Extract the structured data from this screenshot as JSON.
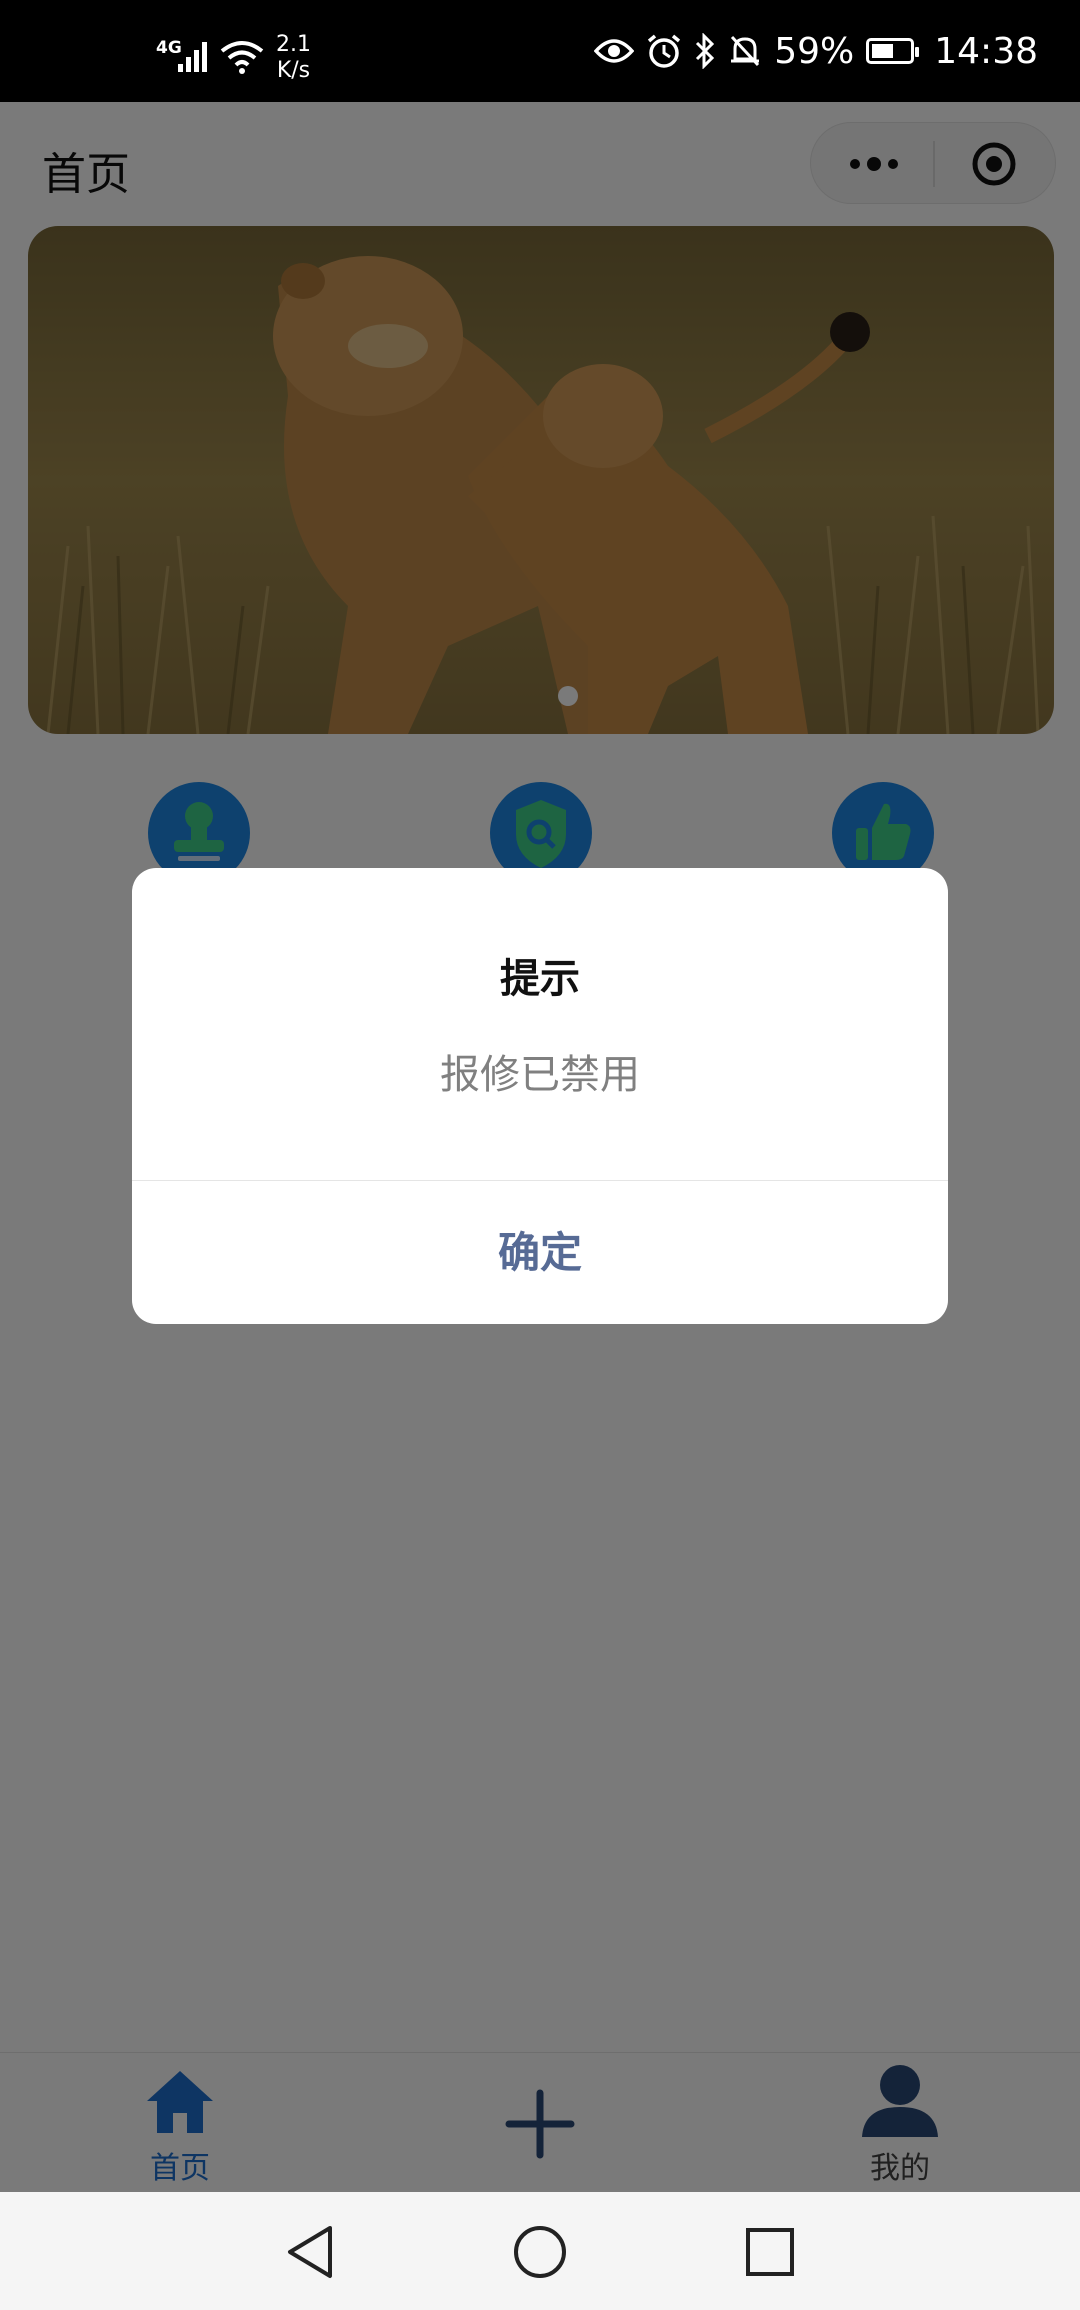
{
  "status_bar": {
    "network": "4G",
    "speed_value": "2.1",
    "speed_unit": "K/s",
    "battery": "59%",
    "time": "14:38",
    "battery_level": 0.59,
    "icons": [
      "signal-icon",
      "wifi-icon",
      "eye-icon",
      "alarm-icon",
      "bluetooth-icon",
      "mute-bell-icon",
      "battery-icon"
    ]
  },
  "nav": {
    "title": "首页",
    "capsule_icons": [
      "more-dots-icon",
      "close-target-icon"
    ]
  },
  "banner": {
    "image": "lioness-and-cub-photo",
    "pagination_active": 0,
    "pagination_count": 1
  },
  "menu": {
    "items": [
      {
        "icon": "stamp-icon",
        "color": "#1e88e5"
      },
      {
        "icon": "shield-search-icon",
        "color": "#1e88e5"
      },
      {
        "icon": "thumbs-up-icon",
        "color": "#1e88e5"
      }
    ]
  },
  "modal": {
    "title": "提示",
    "content": "报修已禁用",
    "confirm_label": "确定",
    "confirm_color": "#576b95"
  },
  "tab_bar": {
    "active_color": "#1e6fd0",
    "inactive_color": "#444444",
    "tabs": [
      {
        "label": "首页",
        "icon": "home-icon",
        "active": true
      },
      {
        "label": "",
        "icon": "plus-icon",
        "active": false
      },
      {
        "label": "我的",
        "icon": "user-icon",
        "active": false
      }
    ]
  },
  "system_nav": {
    "icons": [
      "back-icon",
      "home-circle-icon",
      "recents-icon"
    ]
  }
}
